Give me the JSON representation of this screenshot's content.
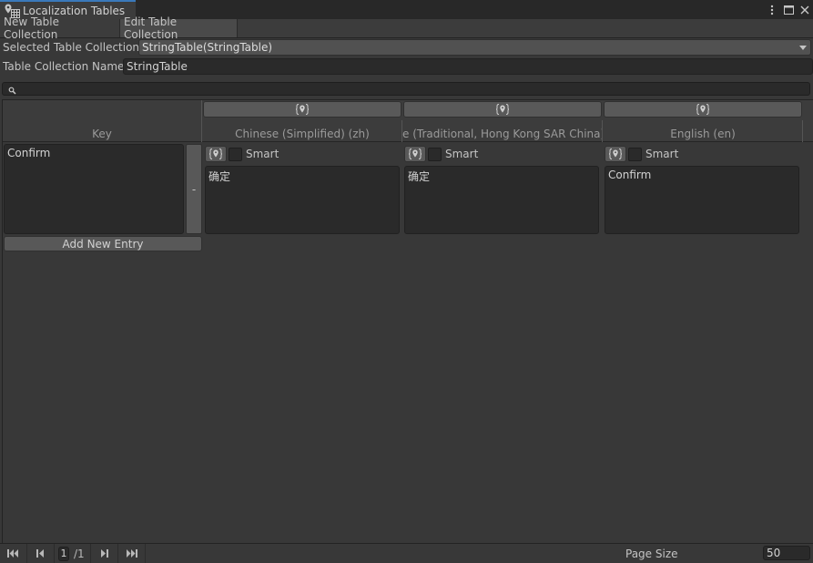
{
  "window": {
    "title": "Localization Tables",
    "tab_icon": "localization-tables-icon",
    "controls": [
      {
        "name": "more-options-icon",
        "glyph": "⋮"
      },
      {
        "name": "maximize-icon",
        "glyph": "🗖"
      },
      {
        "name": "close-icon",
        "glyph": "✕"
      }
    ],
    "accent_color": "#3a79bb"
  },
  "toolbar": {
    "new_table_collection": "New Table Collection",
    "edit_table_collection": "Edit Table Collection"
  },
  "form": {
    "selected_label": "Selected Table Collection",
    "selected_value": "StringTable(StringTable)",
    "name_label": "Table Collection Name",
    "name_value": "StringTable"
  },
  "search": {
    "value": "",
    "icon": "search-icon"
  },
  "table": {
    "key_header": "Key",
    "columns": [
      {
        "label": "Chinese (Simplified) (zh)",
        "metadata_icon": "locale-metadata-icon"
      },
      {
        "label": "Chinese (Traditional, Hong Kong SAR China) (zh-HK)",
        "visible_label": "e (Traditional, Hong Kong SAR China) (",
        "metadata_icon": "locale-metadata-icon"
      },
      {
        "label": "English (en)",
        "metadata_icon": "locale-metadata-icon"
      }
    ],
    "rows": [
      {
        "key": "Confirm",
        "remove_label": "-",
        "entries": [
          {
            "smart_label": "Smart",
            "smart": false,
            "value": "确定"
          },
          {
            "smart_label": "Smart",
            "smart": false,
            "value": "确定"
          },
          {
            "smart_label": "Smart",
            "smart": false,
            "value": "Confirm"
          }
        ]
      }
    ],
    "add_entry_label": "Add New Entry"
  },
  "footer": {
    "first_icon": "⏮",
    "prev_icon": "⏴",
    "current_page": "1",
    "total_pages": "/1",
    "next_icon": "⏵",
    "last_icon": "⏭",
    "page_size_label": "Page Size",
    "page_size_value": "50"
  }
}
